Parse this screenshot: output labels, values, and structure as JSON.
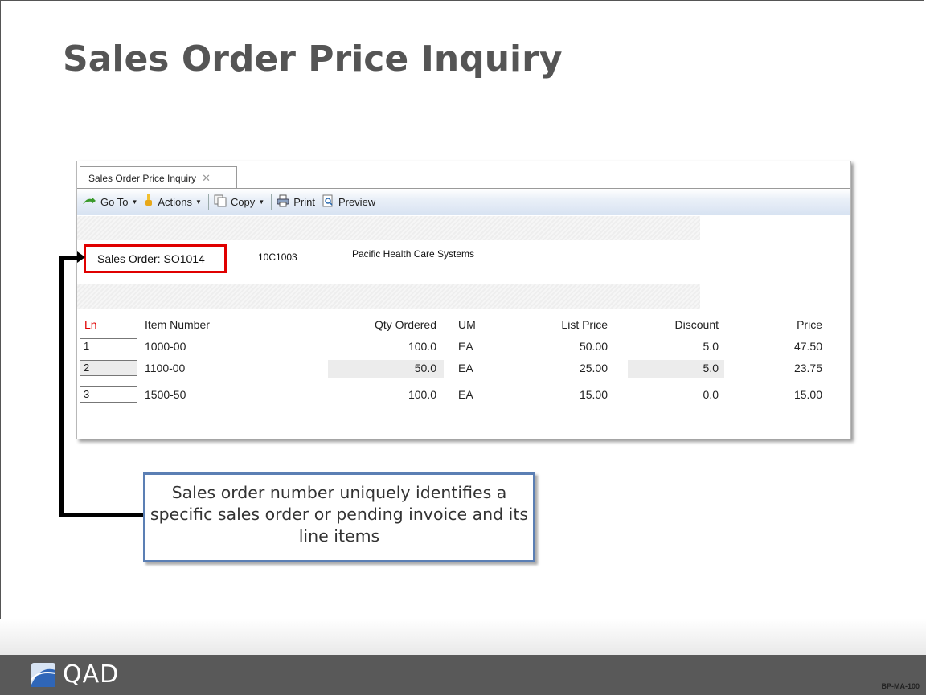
{
  "slide": {
    "title": "Sales Order Price Inquiry",
    "callout": "Sales order number uniquely identifies a specific sales order or pending invoice and its line items",
    "footer_logo": "QAD",
    "slide_code": "BP-MA-100"
  },
  "window": {
    "tab_label": "Sales Order Price Inquiry",
    "toolbar": {
      "goto": "Go To",
      "actions": "Actions",
      "copy": "Copy",
      "print": "Print",
      "preview": "Preview"
    },
    "header": {
      "sales_order": "Sales Order: SO1014",
      "customer_code": "10C1003",
      "customer_name": "Pacific Health Care Systems"
    },
    "columns": {
      "ln": "Ln",
      "item": "Item Number",
      "qty": "Qty Ordered",
      "um": "UM",
      "list": "List Price",
      "discount": "Discount",
      "price": "Price"
    },
    "rows": [
      {
        "ln": "1",
        "item": "1000-00",
        "qty": "100.0",
        "um": "EA",
        "list": "50.00",
        "discount": "5.0",
        "price": "47.50"
      },
      {
        "ln": "2",
        "item": "1100-00",
        "qty": "50.0",
        "um": "EA",
        "list": "25.00",
        "discount": "5.0",
        "price": "23.75"
      },
      {
        "ln": "3",
        "item": "1500-50",
        "qty": "100.0",
        "um": "EA",
        "list": "15.00",
        "discount": "0.0",
        "price": "15.00"
      }
    ],
    "colors": {
      "ln_header": "#e00000",
      "highlight_box": "#e00000",
      "callout_border": "#5b7fb4"
    }
  }
}
